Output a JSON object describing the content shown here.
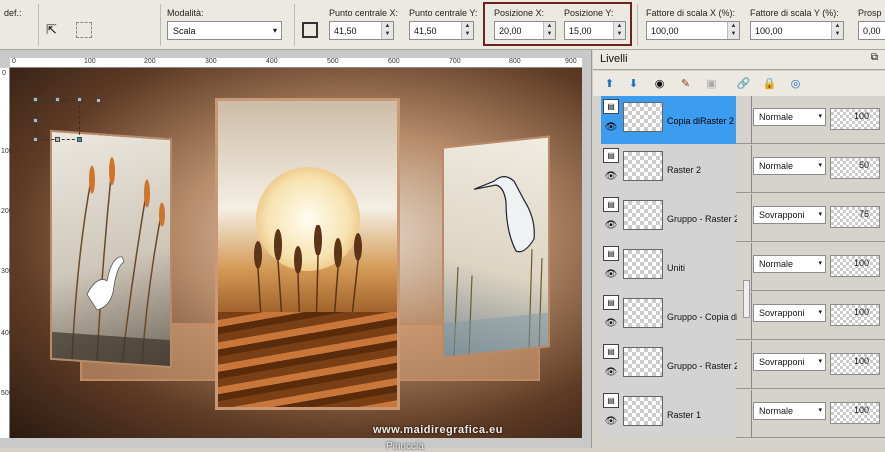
{
  "toolbar": {
    "preset_label": "def.:",
    "mode_label": "Modalità:",
    "mode_value": "Scala",
    "center_x_label": "Punto centrale X:",
    "center_x_value": "41,50",
    "center_y_label": "Punto centrale Y:",
    "center_y_value": "41,50",
    "pos_x_label": "Posizione X:",
    "pos_x_value": "20,00",
    "pos_y_label": "Posizione Y:",
    "pos_y_value": "15,00",
    "scale_x_label": "Fattore di scala X (%):",
    "scale_x_value": "100,00",
    "scale_y_label": "Fattore di scala Y (%):",
    "scale_y_value": "100,00",
    "perspective_label": "Prosp",
    "perspective_value": "0,00",
    "highlight_color": "#6e2418"
  },
  "ruler": {
    "top_ticks": [
      "0",
      "100",
      "200",
      "300",
      "400",
      "500",
      "600",
      "700",
      "800",
      "900"
    ],
    "left_ticks": [
      "0",
      "100",
      "200",
      "300",
      "400",
      "500"
    ]
  },
  "watermark": {
    "name": "Pinuccia",
    "site": "www.maidiregrafica.eu"
  },
  "layers": {
    "title": "Livelli",
    "pin_icon": "pin-icon",
    "rows": [
      {
        "name": "Copia diRaster 2",
        "blend": "Normale",
        "opacity": "100",
        "active": true
      },
      {
        "name": "Raster 2",
        "blend": "Normale",
        "opacity": "50",
        "active": false
      },
      {
        "name": "Gruppo - Raster 2",
        "blend": "Sovrapponi",
        "opacity": "75",
        "active": false
      },
      {
        "name": "Uniti",
        "blend": "Normale",
        "opacity": "100",
        "active": false
      },
      {
        "name": "Gruppo - Copia diRa",
        "blend": "Sovrapponi",
        "opacity": "100",
        "active": false
      },
      {
        "name": "Gruppo - Raster 2",
        "blend": "Sovrapponi",
        "opacity": "100",
        "active": false
      },
      {
        "name": "Raster 1",
        "blend": "Normale",
        "opacity": "100",
        "active": false
      }
    ],
    "active_color": "#3b9cf0"
  }
}
